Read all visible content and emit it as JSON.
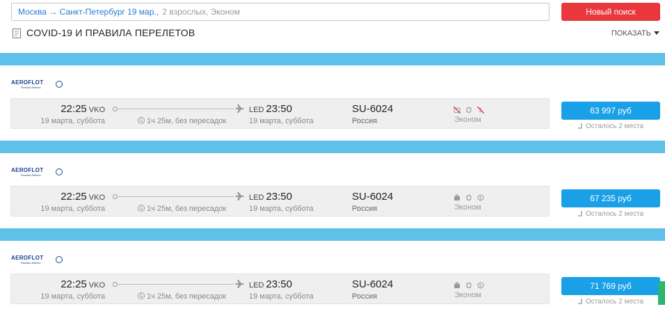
{
  "search": {
    "route": "Москва → Санкт-Петербург 19 мар.,",
    "details": "2 взрослых, Эконом",
    "button_label": "Новый поиск"
  },
  "covid": {
    "title": "COVID-19 И ПРАВИЛА ПЕРЕЛЕТОВ",
    "toggle_label": "ПОКАЗАТЬ"
  },
  "colors": {
    "accent_blue": "#1aa0e6",
    "divider_blue": "#5fc0ea",
    "search_red": "#e8383d",
    "airline_navy": "#1b3f8f"
  },
  "flights": [
    {
      "airline": "AEROFLOT",
      "airline_sub": "Russian Airlines",
      "dep_time": "22:25",
      "dep_code": "VKO",
      "dep_date": "19 марта, суббота",
      "duration": "1ч 25м, без пересадок",
      "arr_code": "LED",
      "arr_time": "23:50",
      "arr_date": "19 марта, суббота",
      "flight_number": "SU-6024",
      "country": "Россия",
      "fare_icons": [
        "no-baggage-icon",
        "exchange-icon",
        "no-refund-icon"
      ],
      "fare_class": "Эконом",
      "price": "63 997 руб",
      "seats_left": "Осталось 2 места"
    },
    {
      "airline": "AEROFLOT",
      "airline_sub": "Russian Airlines",
      "dep_time": "22:25",
      "dep_code": "VKO",
      "dep_date": "19 марта, суббота",
      "duration": "1ч 25м, без пересадок",
      "arr_code": "LED",
      "arr_time": "23:50",
      "arr_date": "19 марта, суббота",
      "flight_number": "SU-6024",
      "country": "Россия",
      "fare_icons": [
        "baggage-icon",
        "exchange-icon",
        "refund-icon"
      ],
      "fare_class": "Эконом",
      "price": "67 235 руб",
      "seats_left": "Осталось 2 места"
    },
    {
      "airline": "AEROFLOT",
      "airline_sub": "Russian Airlines",
      "dep_time": "22:25",
      "dep_code": "VKO",
      "dep_date": "19 марта, суббота",
      "duration": "1ч 25м, без пересадок",
      "arr_code": "LED",
      "arr_time": "23:50",
      "arr_date": "19 марта, суббота",
      "flight_number": "SU-6024",
      "country": "Россия",
      "fare_icons": [
        "baggage-icon",
        "exchange-icon",
        "refund-icon"
      ],
      "fare_class": "Эконом",
      "price": "71 769 руб",
      "seats_left": "Осталось 2 места"
    }
  ]
}
